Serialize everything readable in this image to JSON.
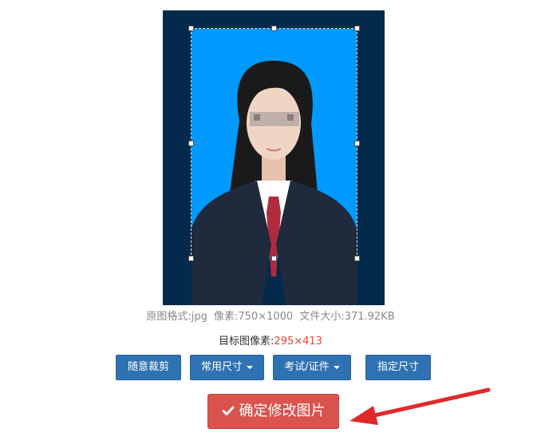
{
  "photo": {
    "background_color": "#042a4b",
    "crop_background_color": "#0099ff"
  },
  "info": {
    "format": "原图格式:jpg",
    "pixels": "像素:750×1000",
    "filesize": "文件大小:371.92KB"
  },
  "target": {
    "label": "目标图像素:",
    "value": "295×413"
  },
  "buttons": {
    "free_crop": "随意裁剪",
    "common_size": "常用尺寸",
    "exam_cert": "考试/证件",
    "custom_size": "指定尺寸",
    "confirm": "确定修改图片"
  },
  "colors": {
    "button_blue": "#2f72b3",
    "confirm_red": "#d9534f",
    "arrow_red": "#e02a2a",
    "target_value_red": "#e8452f"
  },
  "icons": {
    "confirm": "check-icon",
    "dropdown": "caret-down-icon",
    "annotation": "red-arrow-icon"
  }
}
